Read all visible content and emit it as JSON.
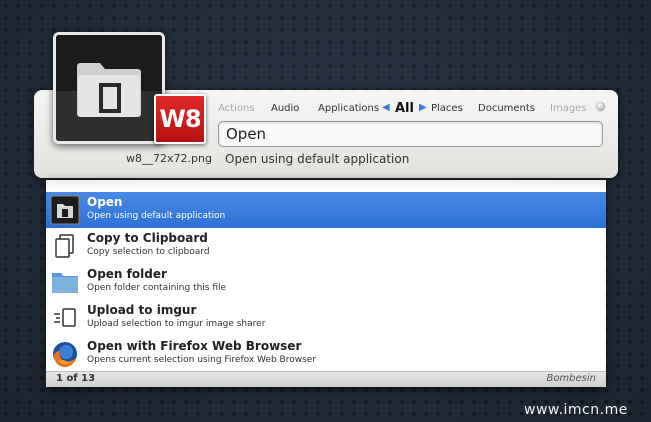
{
  "tabs": [
    {
      "label": "Actions",
      "state": "dim"
    },
    {
      "label": "Audio",
      "state": "normal"
    },
    {
      "label": "Applications",
      "state": "normal"
    },
    {
      "label": "All",
      "state": "active"
    },
    {
      "label": "Places",
      "state": "normal"
    },
    {
      "label": "Documents",
      "state": "normal"
    },
    {
      "label": "Images",
      "state": "dim"
    }
  ],
  "nav": {
    "prev_arrow": "◀",
    "next_arrow": "▶"
  },
  "search": {
    "value": "Open"
  },
  "selection": {
    "filename": "w8__72x72.png",
    "description": "Open using default application",
    "badge": "W8"
  },
  "results": [
    {
      "title": "Open",
      "desc": "Open using default application",
      "icon": "folder-open-icon",
      "selected": true
    },
    {
      "title": "Copy to Clipboard",
      "desc": "Copy selection to clipboard",
      "icon": "clipboard-icon",
      "selected": false
    },
    {
      "title": "Open folder",
      "desc": "Open folder containing this file",
      "icon": "folder-icon",
      "selected": false
    },
    {
      "title": "Upload to imgur",
      "desc": "Upload selection to imgur image sharer",
      "icon": "upload-icon",
      "selected": false
    },
    {
      "title": "Open with Firefox Web Browser",
      "desc": "Opens current selection using Firefox Web Browser",
      "icon": "firefox-icon",
      "selected": false
    }
  ],
  "footer": {
    "count": "1 of 13",
    "brand": "Bombesin"
  },
  "watermark": "www.imcn.me",
  "colors": {
    "accent": "#2d6fd4",
    "badge": "#c8191a",
    "tab_arrow": "#3a79d6"
  }
}
